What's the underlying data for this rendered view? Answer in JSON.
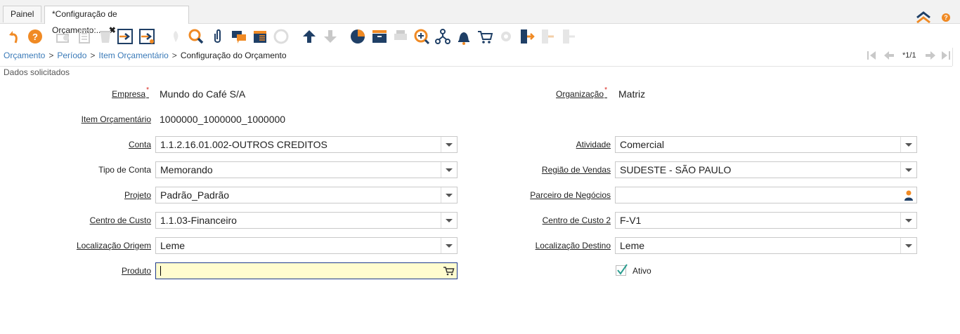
{
  "tabs": [
    {
      "label": "Painel"
    },
    {
      "label": "*Configuração de Orçamento:...",
      "close": "✖"
    }
  ],
  "help_badge": "?",
  "toolbar_icons": [
    "undo-icon",
    "help-icon",
    "new-record-icon",
    "copy-icon",
    "delete-icon",
    "save-and-import-icon",
    "save-and-export-icon",
    "refresh-icon",
    "find-icon",
    "attachment-icon",
    "chat-icon",
    "report-icon",
    "zoom-across-icon",
    "previous-record-icon",
    "next-record-icon",
    "chart-icon",
    "archive-icon",
    "print-icon",
    "zoom-in-icon",
    "workflow-icon",
    "notification-icon",
    "cart-icon",
    "settings-icon",
    "exit-icon",
    "export-icon",
    "import-icon"
  ],
  "breadcrumb": {
    "items": [
      "Orçamento",
      "Período",
      "Item Orçamentário"
    ],
    "separator": ">",
    "current": "Configuração do Orçamento"
  },
  "record_nav": {
    "page": "*1/1"
  },
  "section_title": "Dados solicitados",
  "form": {
    "empresa": {
      "label": "Empresa",
      "value": "Mundo do Café S/A",
      "required": "*"
    },
    "organizacao": {
      "label": "Organização",
      "value": "Matriz",
      "required": "*"
    },
    "item_orcamentario": {
      "label": "Item Orçamentário",
      "value": "1000000_1000000_1000000"
    },
    "conta": {
      "label": "Conta",
      "value": "1.1.2.16.01.002-OUTROS CREDITOS"
    },
    "atividade": {
      "label": "Atividade",
      "value": "Comercial"
    },
    "tipo_conta": {
      "label": "Tipo de Conta",
      "value": "Memorando"
    },
    "regiao_vendas": {
      "label": "Região de Vendas",
      "value": "SUDESTE - SÃO PAULO"
    },
    "projeto": {
      "label": "Projeto",
      "value": "Padrão_Padrão"
    },
    "parceiro": {
      "label": "Parceiro de Negócios",
      "value": ""
    },
    "centro_custo": {
      "label": "Centro de Custo",
      "value": "1.1.03-Financeiro"
    },
    "centro_custo_2": {
      "label": "Centro de Custo 2",
      "value": "F-V1"
    },
    "localizacao_origem": {
      "label": "Localização Origem",
      "value": "Leme"
    },
    "localizacao_destino": {
      "label": "Localização Destino",
      "value": "Leme"
    },
    "produto": {
      "label": "Produto",
      "value": ""
    },
    "ativo": {
      "label": "Ativo",
      "checked": true
    }
  },
  "colors": {
    "accent": "#f08a24",
    "link": "#3a7ab8",
    "focus_bg": "#fffccf",
    "focus_border": "#1e3a8a",
    "required": "#d9241c"
  }
}
